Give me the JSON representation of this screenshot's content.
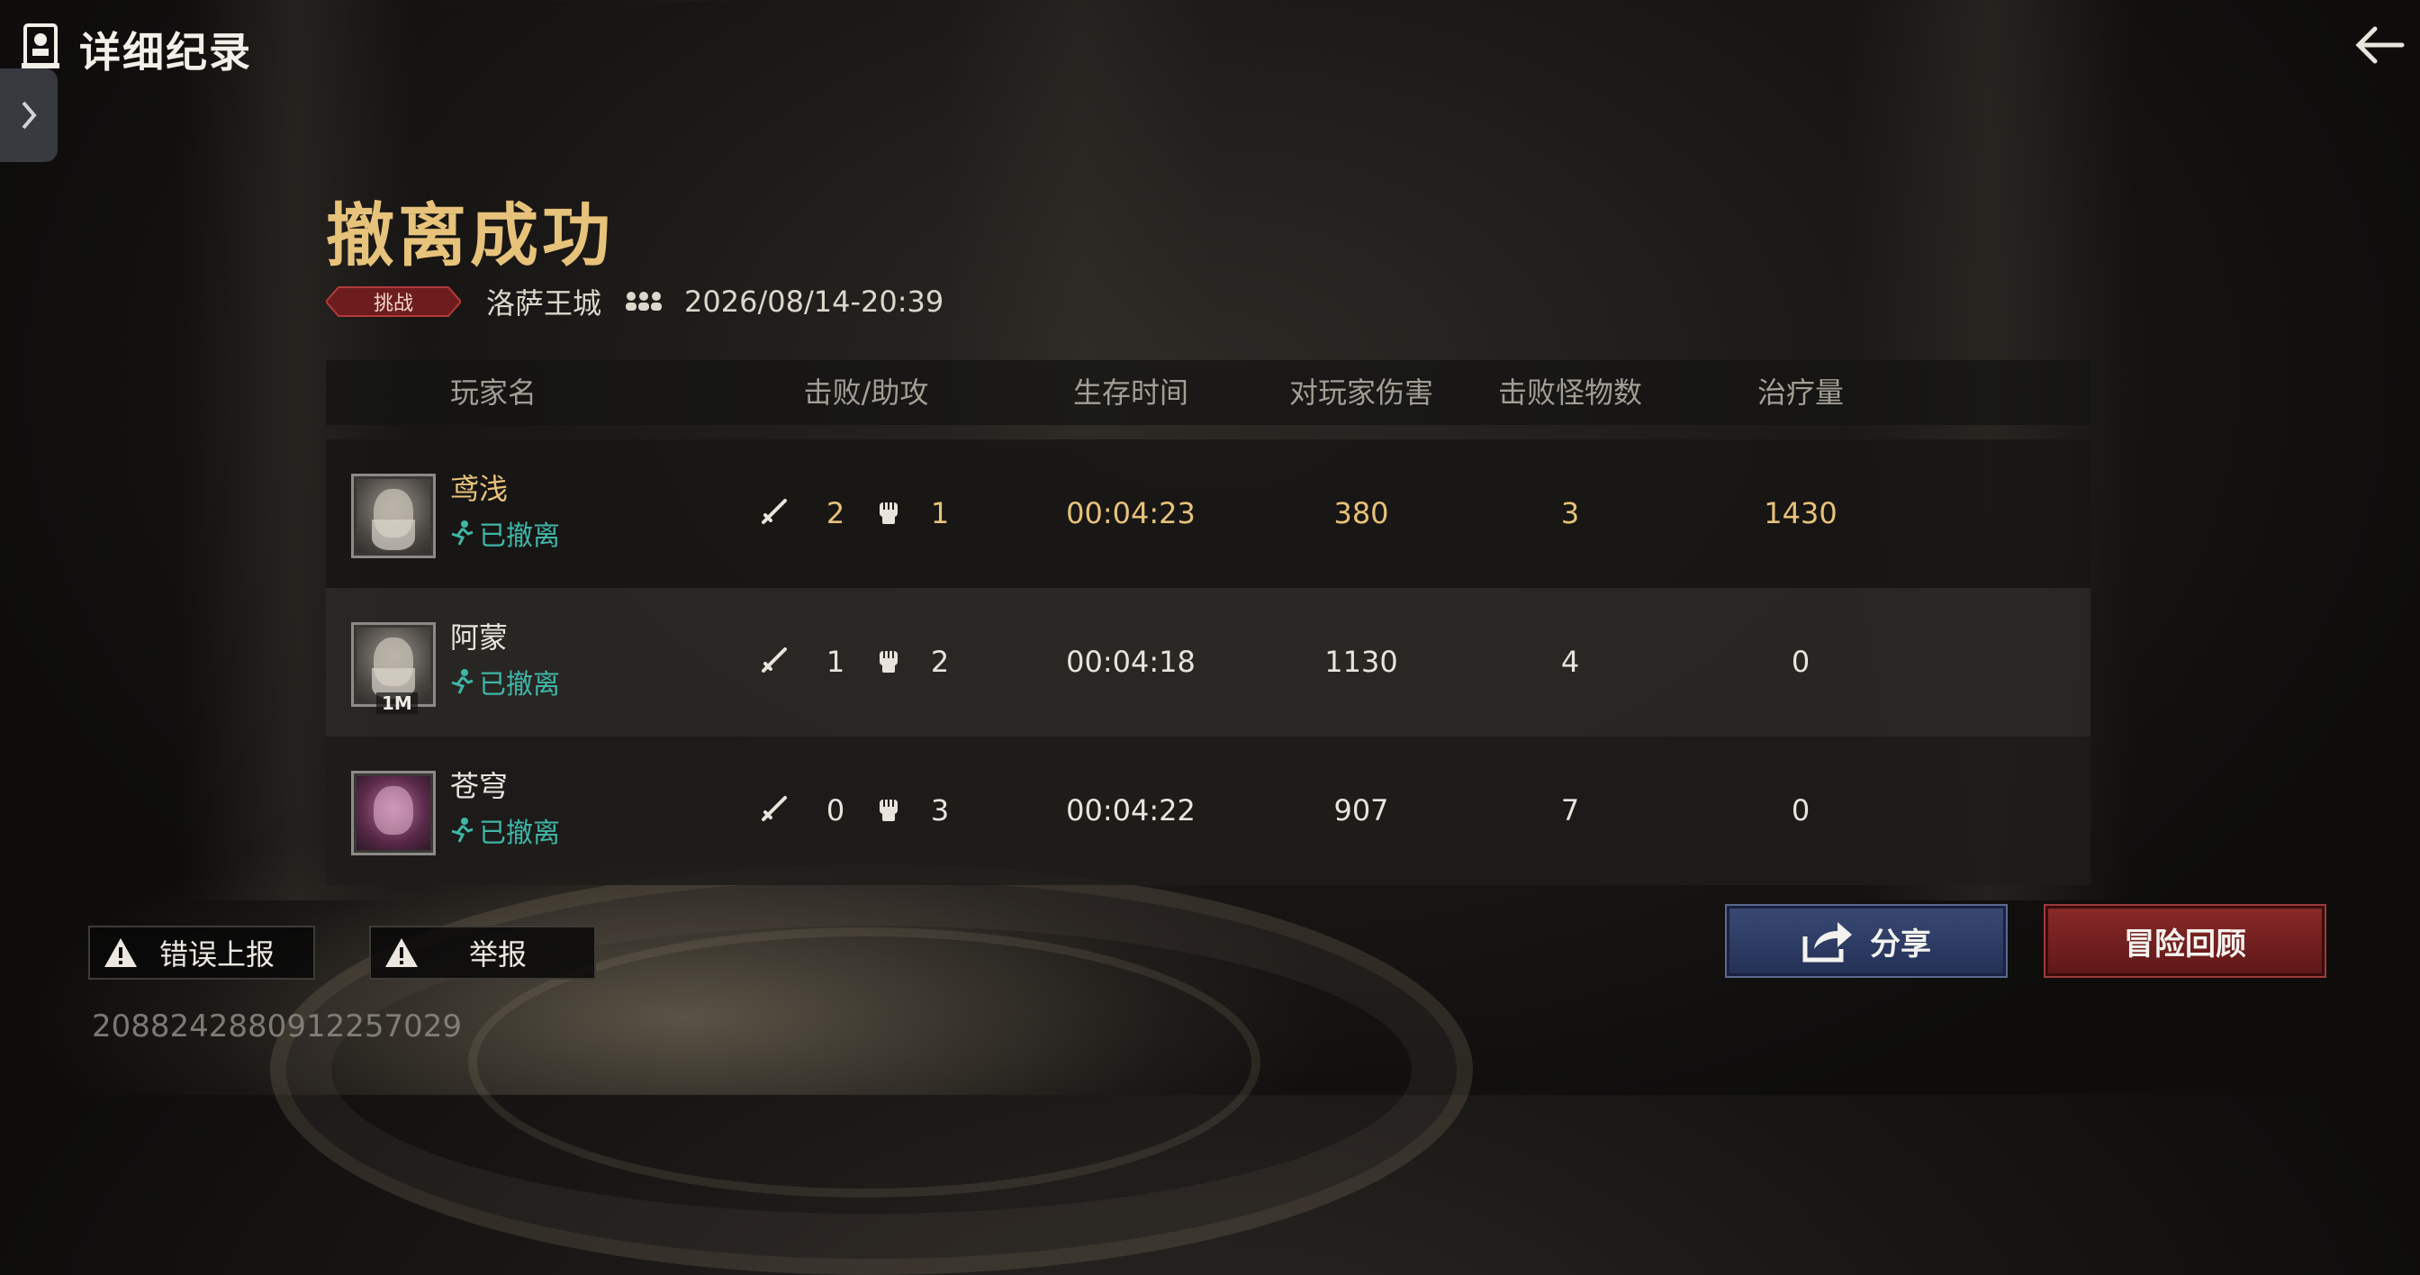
{
  "header": {
    "title": "详细纪录"
  },
  "result": {
    "title": "撤离成功",
    "mode_badge": "挑战",
    "map": "洛萨王城",
    "datetime": "2026/08/14-20:39"
  },
  "table": {
    "columns": [
      "玩家名",
      "击败/助攻",
      "生存时间",
      "对玩家伤害",
      "击败怪物数",
      "治疗量"
    ],
    "rows": [
      {
        "name": "鸢浅",
        "status": "已撤离",
        "kills": "2",
        "assists": "1",
        "survival": "00:04:23",
        "player_damage": "380",
        "monster_kills": "3",
        "healing": "1430",
        "highlight": true
      },
      {
        "name": "阿蒙",
        "status": "已撤离",
        "kills": "1",
        "assists": "2",
        "survival": "00:04:18",
        "player_damage": "1130",
        "monster_kills": "4",
        "healing": "0",
        "avatar_tag": "1M"
      },
      {
        "name": "苍穹",
        "status": "已撤离",
        "kills": "0",
        "assists": "3",
        "survival": "00:04:22",
        "player_damage": "907",
        "monster_kills": "7",
        "healing": "0"
      }
    ]
  },
  "actions": {
    "share": "分享",
    "review": "冒险回顾",
    "report_error": "错误上报",
    "report": "举报"
  },
  "record_id": "2088242880912257029",
  "colors": {
    "gold": "#e7c27a",
    "teal": "#3fb6a8",
    "share_blue": "#2c3a63",
    "review_red": "#7a2323"
  }
}
